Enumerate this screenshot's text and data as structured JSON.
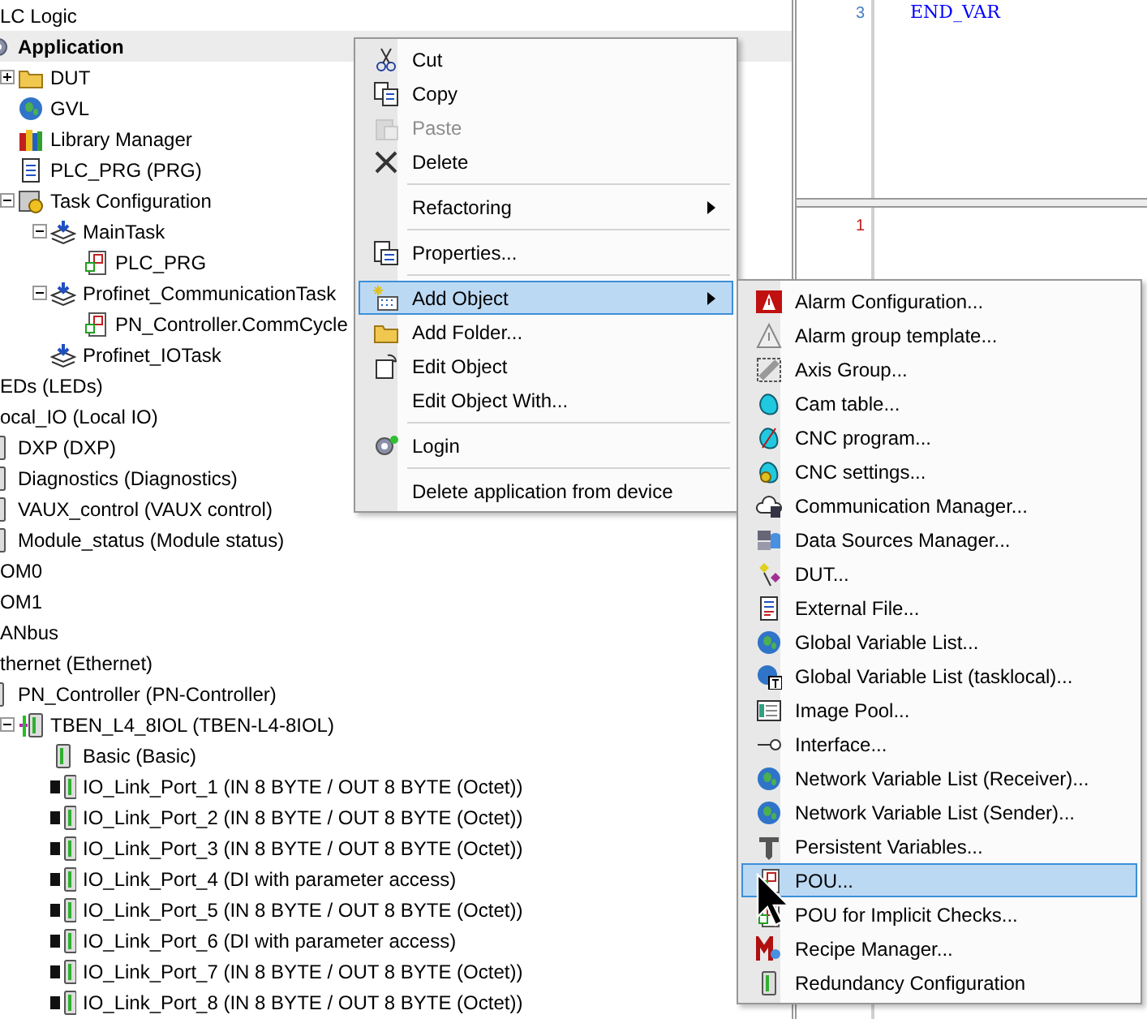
{
  "tree": [
    {
      "label": "LC Logic",
      "selected": false,
      "children": [
        {
          "label": "Application",
          "kind": "gear",
          "bold": true,
          "selected": true,
          "children": [
            {
              "label": "DUT",
              "kind": "folder",
              "expanded": false,
              "selected": false
            },
            {
              "label": "GVL",
              "kind": "globe",
              "selected": false
            },
            {
              "label": "Library Manager",
              "kind": "library",
              "selected": false
            },
            {
              "label": "PLC_PRG (PRG)",
              "kind": "document",
              "selected": false
            },
            {
              "label": "Task Configuration",
              "kind": "taskconfig",
              "expanded": true,
              "selected": false,
              "children": [
                {
                  "label": "MainTask",
                  "kind": "task",
                  "expanded": true,
                  "selected": false,
                  "children": [
                    {
                      "label": "PLC_PRG",
                      "kind": "pou",
                      "selected": false
                    }
                  ]
                },
                {
                  "label": "Profinet_CommunicationTask",
                  "kind": "task",
                  "expanded": true,
                  "selected": false,
                  "children": [
                    {
                      "label": "PN_Controller.CommCycle",
                      "kind": "pou",
                      "selected": false
                    }
                  ]
                },
                {
                  "label": "Profinet_IOTask",
                  "kind": "task",
                  "selected": false
                }
              ]
            }
          ]
        }
      ]
    },
    {
      "label": "EDs (LEDs)",
      "selected": false
    },
    {
      "label": "ocal_IO (Local IO)",
      "selected": false,
      "children": [
        {
          "label": "DXP (DXP)",
          "kind": "module",
          "selected": false
        },
        {
          "label": "Diagnostics (Diagnostics)",
          "kind": "module",
          "selected": false
        },
        {
          "label": "VAUX_control (VAUX control)",
          "kind": "module",
          "selected": false
        },
        {
          "label": "Module_status (Module status)",
          "kind": "module",
          "selected": false
        }
      ]
    },
    {
      "label": "OM0",
      "selected": false
    },
    {
      "label": "OM1",
      "selected": false
    },
    {
      "label": "ANbus",
      "selected": false
    },
    {
      "label": "thernet (Ethernet)",
      "selected": false,
      "children": [
        {
          "label": "PN_Controller (PN-Controller)",
          "kind": "controller",
          "selected": false,
          "children": [
            {
              "label": "TBEN_L4_8IOL (TBEN-L4-8IOL)",
              "kind": "device",
              "expanded": true,
              "selected": false,
              "children": [
                {
                  "label": "Basic (Basic)",
                  "kind": "module",
                  "selected": false
                },
                {
                  "label": "IO_Link_Port_1 (IN 8 BYTE / OUT 8 BYTE (Octet))",
                  "kind": "port",
                  "selected": false
                },
                {
                  "label": "IO_Link_Port_2 (IN 8 BYTE / OUT 8 BYTE (Octet))",
                  "kind": "port",
                  "selected": false
                },
                {
                  "label": "IO_Link_Port_3 (IN 8 BYTE / OUT 8 BYTE (Octet))",
                  "kind": "port",
                  "selected": false
                },
                {
                  "label": "IO_Link_Port_4 (DI with parameter access)",
                  "kind": "port",
                  "selected": false
                },
                {
                  "label": "IO_Link_Port_5 (IN 8 BYTE / OUT 8 BYTE (Octet))",
                  "kind": "port",
                  "selected": false
                },
                {
                  "label": "IO_Link_Port_6 (DI with parameter access)",
                  "kind": "port",
                  "selected": false
                },
                {
                  "label": "IO_Link_Port_7 (IN 8 BYTE / OUT 8 BYTE (Octet))",
                  "kind": "port",
                  "selected": false
                },
                {
                  "label": "IO_Link_Port_8 (IN 8 BYTE / OUT 8 BYTE (Octet))",
                  "kind": "port",
                  "selected": false
                }
              ]
            }
          ]
        }
      ]
    }
  ],
  "editor": {
    "top": {
      "line_number": "3",
      "code": "END_VAR"
    },
    "bottom": {
      "line_number": "1"
    }
  },
  "context_menu": [
    {
      "kind": "cut",
      "label": "Cut",
      "disabled": false,
      "selected": false
    },
    {
      "kind": "copy",
      "label": "Copy",
      "disabled": false,
      "selected": false
    },
    {
      "kind": "paste",
      "label": "Paste",
      "disabled": true,
      "selected": false
    },
    {
      "kind": "delete",
      "label": "Delete",
      "disabled": false,
      "selected": false
    },
    {
      "kind": "separator"
    },
    {
      "kind": "plain",
      "label": "Refactoring",
      "submenu": true,
      "disabled": false,
      "selected": false
    },
    {
      "kind": "separator"
    },
    {
      "kind": "properties",
      "label": "Properties...",
      "disabled": false,
      "selected": false
    },
    {
      "kind": "separator"
    },
    {
      "kind": "addobject",
      "label": "Add Object",
      "submenu": true,
      "disabled": false,
      "selected": true
    },
    {
      "kind": "folder",
      "label": "Add Folder...",
      "disabled": false,
      "selected": false
    },
    {
      "kind": "edit",
      "label": "Edit Object",
      "disabled": false,
      "selected": false
    },
    {
      "kind": "plain",
      "label": "Edit Object With...",
      "disabled": false,
      "selected": false
    },
    {
      "kind": "separator"
    },
    {
      "kind": "login",
      "label": "Login",
      "disabled": false,
      "selected": false
    },
    {
      "kind": "separator"
    },
    {
      "kind": "plain",
      "label": "Delete application from device",
      "disabled": false,
      "selected": false
    }
  ],
  "submenu": [
    {
      "label": "Alarm Configuration...",
      "kind": "alarm",
      "selected": false
    },
    {
      "label": "Alarm group template...",
      "kind": "warning",
      "selected": false
    },
    {
      "label": "Axis Group...",
      "kind": "axis",
      "selected": false
    },
    {
      "label": "Cam table...",
      "kind": "cam",
      "selected": false
    },
    {
      "label": "CNC program...",
      "kind": "cnc",
      "selected": false
    },
    {
      "label": "CNC settings...",
      "kind": "cncsettings",
      "selected": false
    },
    {
      "label": "Communication Manager...",
      "kind": "comm",
      "selected": false
    },
    {
      "label": "Data Sources Manager...",
      "kind": "datasources",
      "selected": false
    },
    {
      "label": "DUT...",
      "kind": "dut",
      "selected": false
    },
    {
      "label": "External File...",
      "kind": "file",
      "selected": false
    },
    {
      "label": "Global Variable List...",
      "kind": "globe",
      "selected": false
    },
    {
      "label": "Global Variable List (tasklocal)...",
      "kind": "globet",
      "selected": false
    },
    {
      "label": "Image Pool...",
      "kind": "imagepool",
      "selected": false
    },
    {
      "label": "Interface...",
      "kind": "interface",
      "selected": false
    },
    {
      "label": "Network Variable List (Receiver)...",
      "kind": "globe",
      "selected": false
    },
    {
      "label": "Network Variable List (Sender)...",
      "kind": "globe",
      "selected": false
    },
    {
      "label": "Persistent Variables...",
      "kind": "persistent",
      "selected": false
    },
    {
      "label": "POU...",
      "kind": "pou",
      "selected": true
    },
    {
      "label": "POU for Implicit Checks...",
      "kind": "pou",
      "selected": false
    },
    {
      "label": "Recipe Manager...",
      "kind": "recipe",
      "selected": false
    },
    {
      "label": "Redundancy Configuration",
      "kind": "module",
      "selected": false
    }
  ]
}
